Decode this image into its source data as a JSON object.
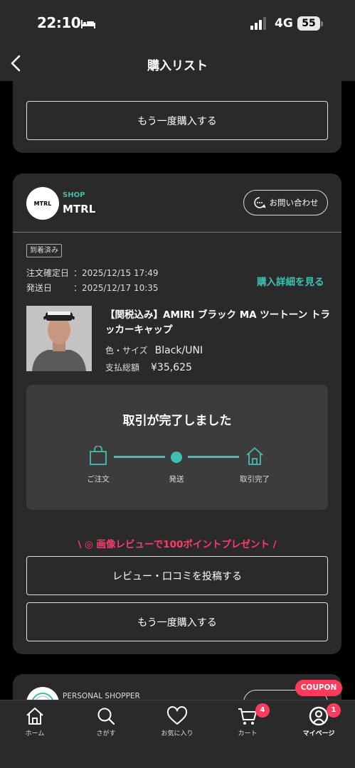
{
  "status_bar": {
    "time": "22:10",
    "network": "4G",
    "battery": "55"
  },
  "nav": {
    "title": "購入リスト"
  },
  "prev_card": {
    "buy_again_label": "もう一度購入する"
  },
  "order_card": {
    "shop": {
      "logo_text": "MTRL",
      "tag": "SHOP",
      "name": "MTRL",
      "contact_label": "お問い合わせ"
    },
    "status_badge": "到着済み",
    "order_confirmed_label": "注文確定日",
    "order_confirmed_value": "：2025/12/15 17:49",
    "shipped_label": "発送日",
    "shipped_value": "：2025/12/17 10:35",
    "detail_link": "購入詳細を見る",
    "product": {
      "title": "【関税込み】AMIRI ブラック MA ツートーン トラッカーキャップ",
      "spec_label": "色・サイズ",
      "spec_value": "Black/UNI",
      "price_label": "支払総額",
      "price_value": "¥35,625"
    },
    "progress": {
      "title": "取引が完了しました",
      "steps": [
        "ご注文",
        "発送",
        "取引完了"
      ]
    },
    "review_promo": "\\ ◎ 画像レビューで100ポイントプレゼント /",
    "review_button": "レビュー・口コミを投稿する",
    "buy_again_label": "もう一度購入する"
  },
  "next_card": {
    "tag": "PERSONAL SHOPPER"
  },
  "coupon_label": "COUPON",
  "tab_bar": {
    "tabs": [
      {
        "label": "ホーム",
        "icon": "home-icon"
      },
      {
        "label": "さがす",
        "icon": "search-icon"
      },
      {
        "label": "お気に入り",
        "icon": "heart-icon"
      },
      {
        "label": "カート",
        "icon": "cart-icon",
        "badge": "4"
      },
      {
        "label": "マイページ",
        "icon": "mypage-icon",
        "badge": "1"
      }
    ]
  },
  "colors": {
    "accent": "#3fbfb0",
    "promo": "#ff3b6b",
    "badge": "#ff3b5c",
    "card_bg": "#2a2a2a"
  }
}
